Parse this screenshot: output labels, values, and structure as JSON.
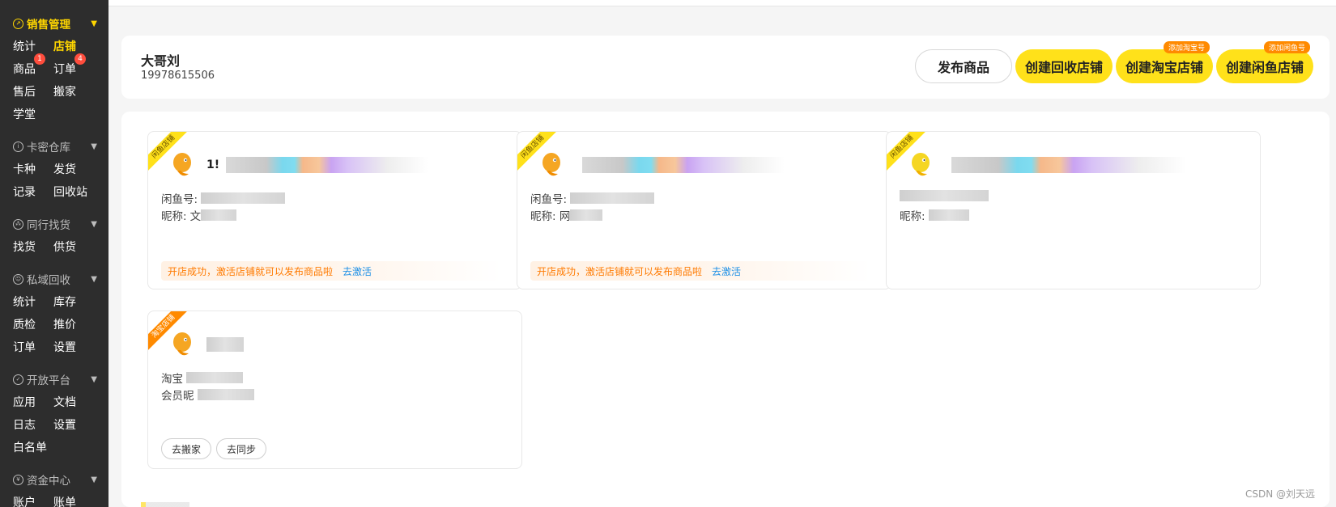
{
  "sidebar": {
    "groups": [
      {
        "title": "销售管理",
        "rows": [
          [
            "统计",
            "店铺"
          ],
          [
            "商品",
            "订单"
          ],
          [
            "售后",
            "搬家"
          ],
          [
            "学堂"
          ]
        ]
      },
      {
        "title": "卡密仓库",
        "rows": [
          [
            "卡种",
            "发货"
          ],
          [
            "记录",
            "回收站"
          ]
        ]
      },
      {
        "title": "同行找货",
        "rows": [
          [
            "找货",
            "供货"
          ]
        ]
      },
      {
        "title": "私域回收",
        "rows": [
          [
            "统计",
            "库存"
          ],
          [
            "质检",
            "推价"
          ],
          [
            "订单",
            "设置"
          ]
        ]
      },
      {
        "title": "开放平台",
        "rows": [
          [
            "应用",
            "文档"
          ],
          [
            "日志",
            "设置"
          ],
          [
            "白名单"
          ]
        ]
      },
      {
        "title": "资金中心",
        "rows": [
          [
            "账户",
            "账单"
          ]
        ]
      }
    ],
    "badges": {
      "goods": "1",
      "orders": "4"
    }
  },
  "header": {
    "user_name": "大哥刘",
    "phone": "19978615506",
    "buttons": {
      "publish": "发布商品",
      "recycle": "创建回收店铺",
      "taobao": "创建淘宝店铺",
      "xianyu": "创建闲鱼店铺"
    },
    "badges": {
      "taobao": "添加淘宝号",
      "xianyu": "添加闲鱼号"
    }
  },
  "stores": [
    {
      "ribbon": "闲鱼店铺",
      "title_prefix": "1!",
      "line1_label": "闲鱼号:",
      "line2_label": "昵称:",
      "line2_suffix": "文",
      "notice": "开店成功，激活店铺就可以发布商品啦",
      "notice_action": "去激活"
    },
    {
      "ribbon": "闲鱼店铺",
      "line1_label": "闲鱼号:",
      "line2_label": "昵称: 网",
      "notice": "开店成功，激活店铺就可以发布商品啦",
      "notice_action": "去激活"
    },
    {
      "ribbon": "闲鱼店铺",
      "line2_label": "昵称:"
    },
    {
      "ribbon": "淘宝店铺",
      "line1_label": "淘宝",
      "line2_label": "会员昵",
      "buttons": [
        "去搬家",
        "去同步"
      ]
    }
  ],
  "watermark": "CSDN @刘天远",
  "colors": {
    "accent": "#ffe11a",
    "sidebar_bg": "#2d2d2d",
    "active_text": "#ffd600",
    "notice_text": "#ff7a00",
    "link": "#1e90e6",
    "badge": "#ff4d3d"
  }
}
